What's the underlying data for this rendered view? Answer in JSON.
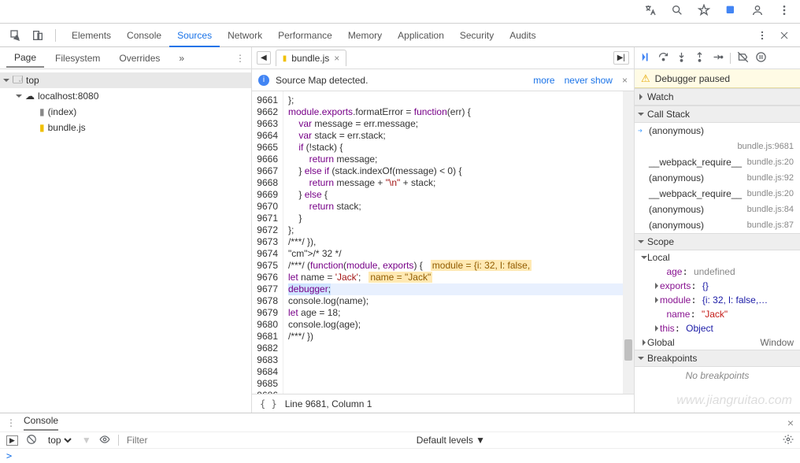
{
  "browser_icons": [
    "translate",
    "find",
    "star",
    "extensions",
    "user",
    "menu"
  ],
  "devtools_tabs": [
    "Elements",
    "Console",
    "Sources",
    "Network",
    "Performance",
    "Memory",
    "Application",
    "Security",
    "Audits"
  ],
  "devtools_active": "Sources",
  "nav": {
    "tabs": [
      "Page",
      "Filesystem",
      "Overrides"
    ],
    "active": "Page",
    "more": "»",
    "tree": {
      "root": "top",
      "host": "localhost:8080",
      "files": [
        "(index)",
        "bundle.js"
      ]
    }
  },
  "editor": {
    "file": "bundle.js",
    "info_msg": "Source Map detected.",
    "info_links": [
      "more",
      "never show"
    ],
    "status": "Line 9681, Column 1",
    "gutter_start": 9661,
    "code_lines": [
      "};",
      "",
      "module.exports.formatError = function(err) {",
      "    var message = err.message;",
      "    var stack = err.stack;",
      "    if (!stack) {",
      "        return message;",
      "    } else if (stack.indexOf(message) < 0) {",
      "        return message + \"\\n\" + stack;",
      "    } else {",
      "        return stack;",
      "    }",
      "};",
      "",
      "",
      "/***/ }),",
      "/* 32 */",
      "/***/ (function(module, exports) {",
      "",
      "let name = 'Jack';",
      "debugger;",
      "console.log(name);",
      "let age = 18;",
      "console.log(age);",
      "",
      "/***/ })",
      ""
    ],
    "inline_hints": {
      "9678": "module = {i: 32, l: false,",
      "9680": "name = \"Jack\""
    },
    "paused_line": 9681
  },
  "debugger": {
    "banner": "Debugger paused",
    "panes": {
      "watch": "Watch",
      "callstack": "Call Stack",
      "scope": "Scope",
      "breakpoints": "Breakpoints"
    },
    "callstack": [
      {
        "fn": "(anonymous)",
        "loc": "bundle.js:9681",
        "current": true
      },
      {
        "fn": "__webpack_require__",
        "loc": "bundle.js:20"
      },
      {
        "fn": "(anonymous)",
        "loc": "bundle.js:92"
      },
      {
        "fn": "__webpack_require__",
        "loc": "bundle.js:20"
      },
      {
        "fn": "(anonymous)",
        "loc": "bundle.js:84"
      },
      {
        "fn": "(anonymous)",
        "loc": "bundle.js:87"
      }
    ],
    "scope": {
      "local_label": "Local",
      "vars": [
        {
          "k": "age",
          "v": "undefined",
          "cls": "g"
        },
        {
          "k": "exports",
          "v": "{}",
          "cls": "v",
          "exp": true
        },
        {
          "k": "module",
          "v": "{i: 32, l: false,…",
          "cls": "v",
          "exp": true
        },
        {
          "k": "name",
          "v": "\"Jack\"",
          "cls": "s"
        },
        {
          "k": "this",
          "v": "Object",
          "cls": "v",
          "exp": true
        }
      ],
      "global_label": "Global",
      "global_val": "Window"
    },
    "no_breakpoints": "No breakpoints"
  },
  "console": {
    "label": "Console",
    "ctx": "top",
    "filter_ph": "Filter",
    "levels": "Default levels ▼",
    "prompt": ">"
  },
  "watermark": "www.jiangruitao.com"
}
